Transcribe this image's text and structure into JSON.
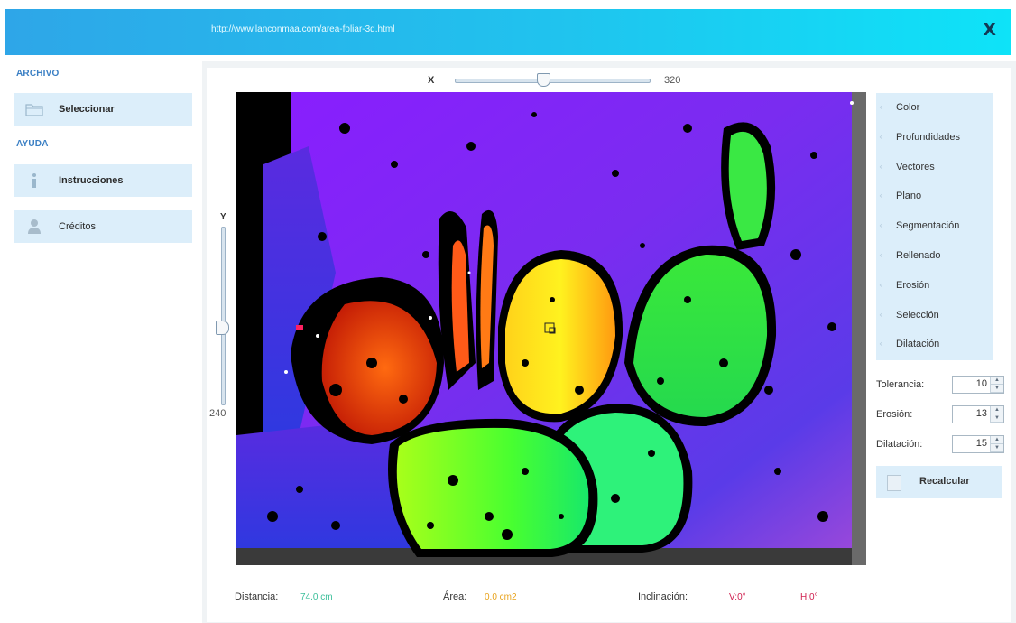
{
  "window": {
    "url": "http://www.lanconmaa.com/area-foliar-3d.html",
    "close_label": "X"
  },
  "sidebar": {
    "archivo_title": "ARCHIVO",
    "seleccionar_label": "Seleccionar",
    "ayuda_title": "AYUDA",
    "instrucciones_label": "Instrucciones",
    "creditos_label": "Créditos"
  },
  "controls": {
    "x_label": "X",
    "x_value": "320",
    "x_slider_fraction": 0.45,
    "y_label": "Y",
    "y_value": "240",
    "y_slider_fraction": 0.57
  },
  "modes": [
    {
      "label": "Color"
    },
    {
      "label": "Profundidades"
    },
    {
      "label": "Vectores"
    },
    {
      "label": "Plano"
    },
    {
      "label": "Segmentación"
    },
    {
      "label": "Rellenado"
    },
    {
      "label": "Erosión"
    },
    {
      "label": "Selección"
    },
    {
      "label": "Dilatación"
    }
  ],
  "params": {
    "tolerancia_label": "Tolerancia:",
    "tolerancia_value": "10",
    "erosion_label": "Erosión:",
    "erosion_value": "13",
    "dilatacion_label": "Dilatación:",
    "dilatacion_value": "15",
    "recalcular_label": "Recalcular"
  },
  "status": {
    "distancia_label": "Distancia:",
    "distancia_value": "74.0 cm",
    "area_label": "Área:",
    "area_value": "0.0 cm2",
    "inclinacion_label": "Inclinación:",
    "v_value": "V:0°",
    "h_value": "H:0°"
  },
  "colors": {
    "accent": "#2ea6e8",
    "panel_bg": "#dceefa",
    "distancia_color": "#3bbf9a",
    "area_color": "#e8a21a",
    "v_color": "#d02050",
    "h_color": "#d02050"
  }
}
